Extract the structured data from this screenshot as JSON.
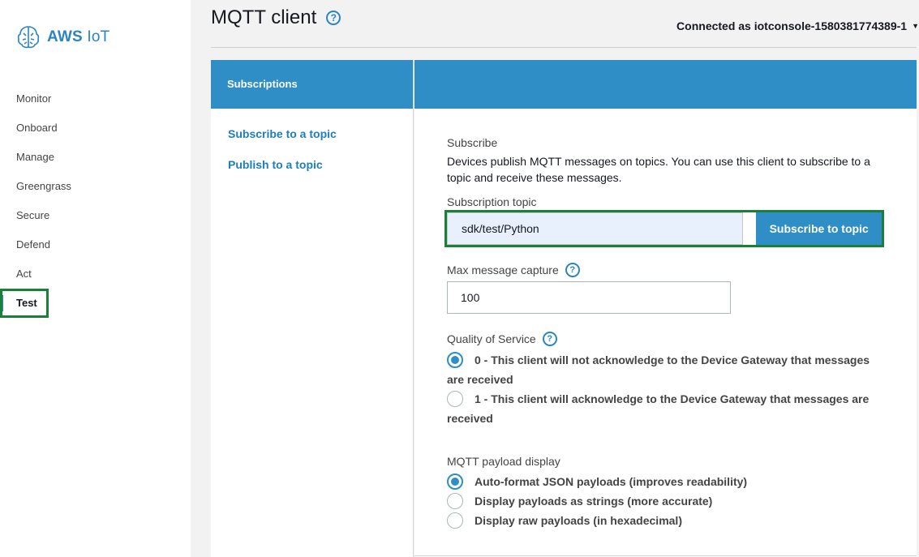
{
  "brand": {
    "name_bold": "AWS",
    "name_rest": " IoT"
  },
  "sidebar": {
    "items": [
      {
        "label": "Monitor"
      },
      {
        "label": "Onboard"
      },
      {
        "label": "Manage"
      },
      {
        "label": "Greengrass"
      },
      {
        "label": "Secure"
      },
      {
        "label": "Defend"
      },
      {
        "label": "Act"
      },
      {
        "label": "Test",
        "active": true
      }
    ]
  },
  "header": {
    "title": "MQTT client",
    "help_glyph": "?",
    "connection": "Connected as iotconsole-1580381774389-1"
  },
  "left_panel": {
    "header": "Subscriptions",
    "links": [
      "Subscribe to a topic",
      "Publish to a topic"
    ]
  },
  "subscribe": {
    "title": "Subscribe",
    "description": "Devices publish MQTT messages on topics. You can use this client to subscribe to a topic and receive these messages.",
    "topic_label": "Subscription topic",
    "topic_value": "sdk/test/Python",
    "button": "Subscribe to topic",
    "max_label": "Max message capture",
    "max_value": "100",
    "qos_label": "Quality of Service",
    "qos_options": [
      {
        "label": "0 - This client will not acknowledge to the Device Gateway that messages are received",
        "selected": true
      },
      {
        "label": "1 - This client will acknowledge to the Device Gateway that messages are received",
        "selected": false
      }
    ],
    "payload_label": "MQTT payload display",
    "payload_options": [
      {
        "label": "Auto-format JSON payloads (improves readability)",
        "selected": true
      },
      {
        "label": "Display payloads as strings (more accurate)",
        "selected": false
      },
      {
        "label": "Display raw payloads (in hexadecimal)",
        "selected": false
      }
    ]
  },
  "colors": {
    "accent": "#2e8ec5",
    "highlight": "#1a7f37"
  }
}
